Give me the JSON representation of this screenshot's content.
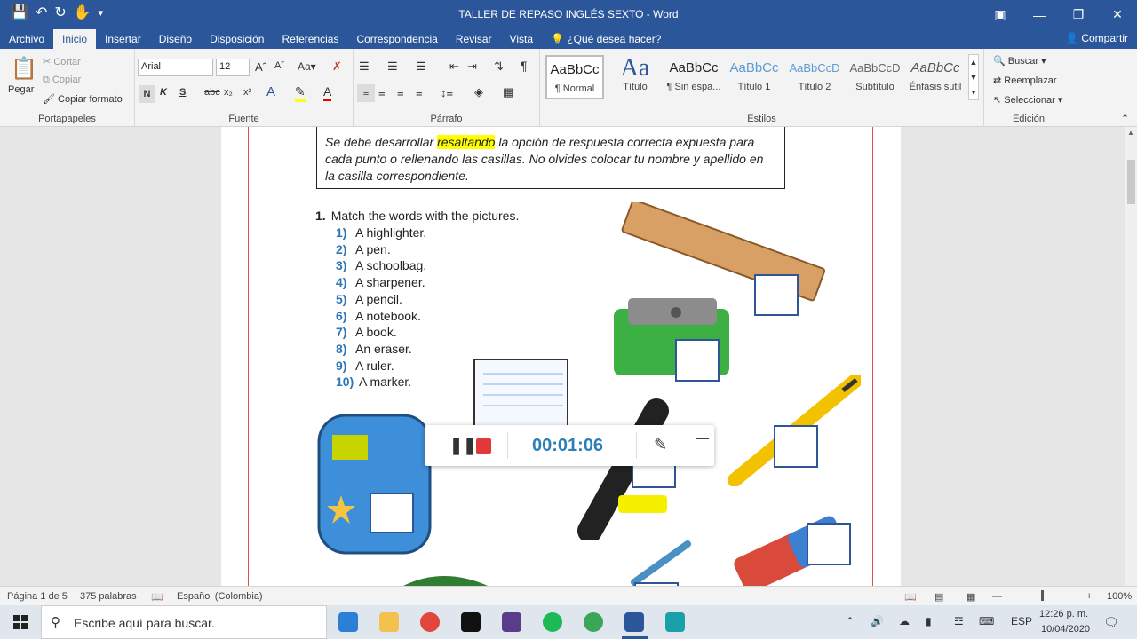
{
  "window": {
    "title": "TALLER DE REPASO INGLÉS SEXTO  -  Word"
  },
  "ribbon_tabs": [
    "Archivo",
    "Inicio",
    "Insertar",
    "Diseño",
    "Disposición",
    "Referencias",
    "Correspondencia",
    "Revisar",
    "Vista"
  ],
  "tell_me": "¿Qué desea hacer?",
  "share_label": "Compartir",
  "clipboard": {
    "paste": "Pegar",
    "cut": "Cortar",
    "copy": "Copiar",
    "format_painter": "Copiar formato",
    "group": "Portapapeles"
  },
  "font": {
    "family": "Arial",
    "size": "12",
    "bold": "N",
    "italic": "K",
    "underline": "S",
    "strike": "abc",
    "sub": "x₂",
    "sup": "x²",
    "group": "Fuente"
  },
  "paragraph": {
    "group": "Párrafo"
  },
  "styles": {
    "group": "Estilos",
    "items": [
      {
        "preview": "AaBbCc",
        "name": "¶ Normal"
      },
      {
        "preview": "Aa",
        "name": "Título"
      },
      {
        "preview": "AaBbCc",
        "name": "¶ Sin espa..."
      },
      {
        "preview": "AaBbCc",
        "name": "Título 1"
      },
      {
        "preview": "AaBbCcD",
        "name": "Título 2"
      },
      {
        "preview": "AaBbCcD",
        "name": "Subtítulo"
      },
      {
        "preview": "AaBbCc",
        "name": "Énfasis sutil"
      }
    ]
  },
  "editing": {
    "find": "Buscar",
    "replace": "Reemplazar",
    "select": "Seleccionar",
    "group": "Edición"
  },
  "document": {
    "instr_before": "Se debe desarrollar ",
    "instr_highlight": "resaltando",
    "instr_after": " la opción de respuesta correcta expuesta para cada punto o rellenando las casillas. No olvides colocar tu nombre y apellido en la casilla correspondiente.",
    "q_number": "1.",
    "q_text": "Match the words with the pictures.",
    "items": [
      {
        "n": "1)",
        "t": "A highlighter."
      },
      {
        "n": "2)",
        "t": "A pen."
      },
      {
        "n": "3)",
        "t": "A schoolbag."
      },
      {
        "n": "4)",
        "t": "A sharpener."
      },
      {
        "n": "5)",
        "t": "A pencil."
      },
      {
        "n": "6)",
        "t": "A notebook."
      },
      {
        "n": "7)",
        "t": "A book."
      },
      {
        "n": "8)",
        "t": "An eraser."
      },
      {
        "n": "9)",
        "t": "A ruler."
      },
      {
        "n": "10)",
        "t": "A marker."
      }
    ]
  },
  "recorder": {
    "time": "00:01:06"
  },
  "status": {
    "page": "Página 1 de 5",
    "words": "375 palabras",
    "language": "Español (Colombia)",
    "zoom": "100%"
  },
  "taskbar": {
    "search_placeholder": "Escribe aquí para buscar.",
    "lang": "ESP",
    "time": "12:26 p. m.",
    "date": "10/04/2020"
  }
}
